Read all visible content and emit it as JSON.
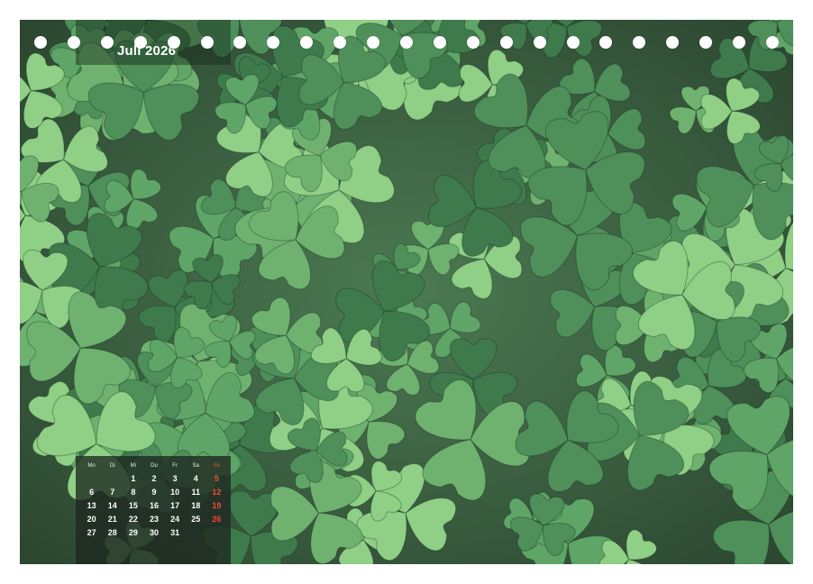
{
  "calendar": {
    "month_title": "Juli 2026",
    "weekdays": [
      "Mo",
      "Di",
      "Mi",
      "Do",
      "Fr",
      "Sa",
      "So"
    ],
    "weeks": [
      [
        "",
        "",
        "1",
        "2",
        "3",
        "4",
        "5"
      ],
      [
        "6",
        "7",
        "8",
        "9",
        "10",
        "11",
        "12"
      ],
      [
        "13",
        "14",
        "15",
        "16",
        "17",
        "18",
        "19"
      ],
      [
        "20",
        "21",
        "22",
        "23",
        "24",
        "25",
        "26"
      ],
      [
        "27",
        "28",
        "29",
        "30",
        "31",
        "",
        ""
      ]
    ]
  },
  "colors": {
    "sunday": "#f0483f",
    "leaf_light": "#8fcf86",
    "leaf_mid": "#5fa567",
    "leaf_dark": "#3f7a4c",
    "background_dark": "#2f4a32"
  },
  "binding": {
    "ring_count": 23
  }
}
